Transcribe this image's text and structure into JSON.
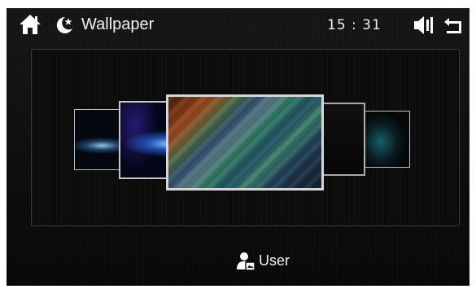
{
  "header": {
    "title": "Wallpaper",
    "clock": "15 : 31",
    "icons": {
      "home": "home-icon",
      "night_mode": "moon-star-icon",
      "volume": "volume-icon",
      "back": "back-arrow-icon"
    }
  },
  "carousel": {
    "thumbnails": [
      {
        "id": "wallpaper-1",
        "desc_icon": "blue-wave"
      },
      {
        "id": "wallpaper-2",
        "desc_icon": "blue-light-streaks"
      },
      {
        "id": "wallpaper-3",
        "desc_icon": "diagonal-color-streaks",
        "selected": true
      },
      {
        "id": "wallpaper-4",
        "desc_icon": "dark"
      },
      {
        "id": "wallpaper-5",
        "desc_icon": "teal-glow"
      }
    ]
  },
  "footer": {
    "user_label": "User",
    "user_icon": "user-icon"
  },
  "colors": {
    "background": "#0c0c0c",
    "text": "#f2f2f2",
    "frame": "#d6d6d6"
  }
}
